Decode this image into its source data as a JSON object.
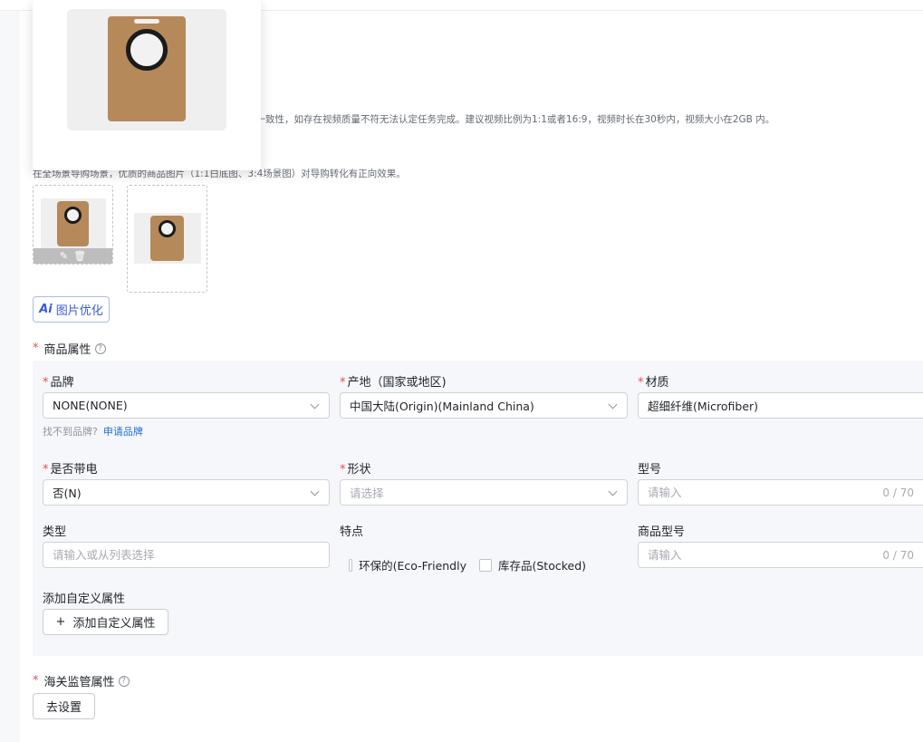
{
  "video_hint": "息一致性，如存在视频质量不符无法认定任务完成。建议视频比例为1:1或者16:9，视频时长在30秒内，视频大小在2GB 内。",
  "image_hint": "在全场景导购场景，优质的商品图片（1:1白底图、3:4场景图）对导购转化有正向效果。",
  "image_optimize_button": {
    "ai_mark": "Ai",
    "label": "图片优化"
  },
  "product_attributes": {
    "title": "商品属性",
    "fields": {
      "brand": {
        "label": "品牌",
        "value": "NONE(NONE)",
        "note": "找不到品牌?",
        "note_link": "申请品牌"
      },
      "origin": {
        "label": "产地（国家或地区)",
        "value": "中国大陆(Origin)(Mainland China)"
      },
      "material": {
        "label": "材质",
        "value": "超细纤维(Microfiber)"
      },
      "electric": {
        "label": "是否带电",
        "value": "否(N)"
      },
      "shape": {
        "label": "形状",
        "placeholder": "请选择"
      },
      "model": {
        "label": "型号",
        "placeholder": "请输入",
        "counter": "0 / 70"
      },
      "type": {
        "label": "类型",
        "placeholder": "请输入或从列表选择"
      },
      "features": {
        "label": "特点",
        "options": [
          "环保的(Eco-Friendly",
          "库存品(Stocked)"
        ]
      },
      "product_model": {
        "label": "商品型号",
        "placeholder": "请输入",
        "counter": "0 / 70"
      }
    },
    "custom": {
      "label": "添加自定义属性",
      "button": "添加自定义属性"
    }
  },
  "customs": {
    "title": "海关监管属性",
    "button": "去设置"
  },
  "icons": {
    "help": "?",
    "plus": "+",
    "edit": "✎",
    "delete": "🗑"
  },
  "colors": {
    "required": "#e34d59",
    "link": "#1f6fd6",
    "ai_accent": "#3a5bd9",
    "bag": "#b5895a"
  }
}
